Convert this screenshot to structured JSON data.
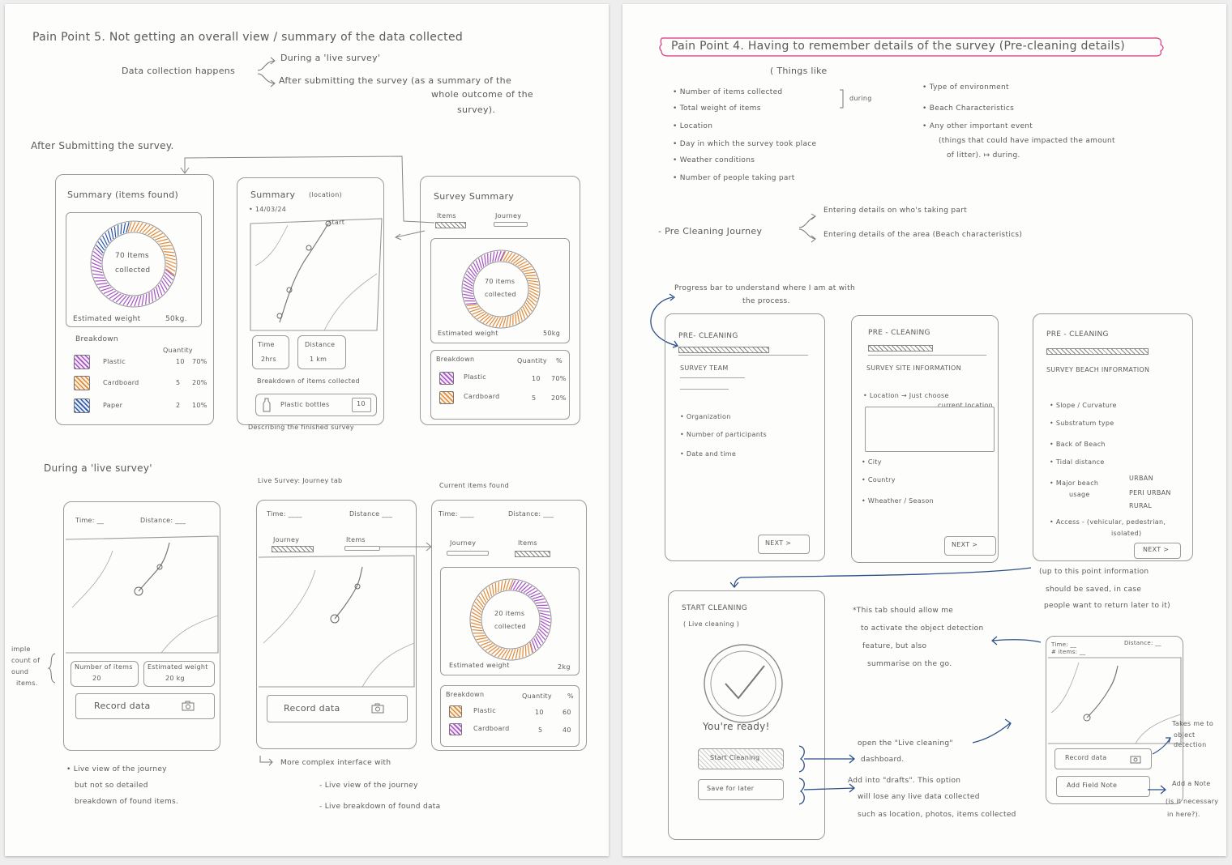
{
  "colors": {
    "plastic": "#a352c4",
    "cardboard": "#e08a3a",
    "paper": "#2a55a8",
    "pink_highlight": "#e0508f",
    "blue_arrow": "#2b4f86",
    "pencil": "#5a5a5a"
  },
  "left": {
    "title": "Pain Point 5.  Not getting an overall view / summary of the data collected",
    "collection_label": "Data collection happens",
    "branch1": "During a 'live survey'",
    "branch2_l1": "After submitting the survey (as a summary of the",
    "branch2_l2": "whole outcome of the",
    "branch2_l3": "survey).",
    "section_after": "After Submitting the survey.",
    "s1": {
      "title": "Summary (items found)",
      "donut_l1": "70 Items",
      "donut_l2": "collected",
      "weight_label": "Estimated weight",
      "weight_value": "50kg.",
      "breakdown": "Breakdown",
      "quantity": "Quantity",
      "rows": [
        {
          "name": "Plastic",
          "qty": "10",
          "pct": "70%"
        },
        {
          "name": "Cardboard",
          "qty": "5",
          "pct": "20%"
        },
        {
          "name": "Paper",
          "qty": "2",
          "pct": "10%"
        }
      ]
    },
    "s2": {
      "title": "Summary",
      "subtitle": "(location)",
      "date": "• 14/03/24",
      "start": "start",
      "time_label": "Time",
      "time_value": "2hrs",
      "distance_label": "Distance",
      "distance_value": "1 km",
      "breakdown": "Breakdown of items collected",
      "item": "Plastic bottles",
      "item_count": "10",
      "caption": "Describing the finished survey"
    },
    "s3": {
      "title": "Survey Summary",
      "tab_items": "Items",
      "tab_journey": "Journey",
      "donut_l1": "70 items",
      "donut_l2": "collected",
      "weight_label": "Estimated weight",
      "weight_value": "50kg",
      "breakdown": "Breakdown",
      "quantity": "Quantity",
      "pct_head": "%",
      "rows": [
        {
          "name": "Plastic",
          "qty": "10",
          "pct": "70%"
        },
        {
          "name": "Cardboard",
          "qty": "5",
          "pct": "20%"
        }
      ]
    },
    "section_live": "During a 'live survey'",
    "l1": {
      "time": "Time: __",
      "distance": "Distance: ___",
      "count_label": "Number of items",
      "count_value": "20",
      "weight_label": "Estimated weight",
      "weight_value": "20 kg",
      "record": "Record data"
    },
    "side_note": [
      "imple",
      "count of",
      "ound",
      "items."
    ],
    "l2": {
      "heading": "Live Survey: Journey tab",
      "time": "Time: ____",
      "distance": "Distance ___",
      "tab_journey": "Journey",
      "tab_items": "Items",
      "record": "Record data"
    },
    "l3": {
      "heading": "Current items found",
      "time": "Time: ____",
      "distance": "Distance: ___",
      "tab_journey": "Journey",
      "tab_items": "Items",
      "donut_l1": "20 items",
      "donut_l2": "collected",
      "weight_label": "Estimated weight",
      "weight_value": "2kg",
      "breakdown": "Breakdown",
      "quantity": "Quantity",
      "pct_head": "%",
      "rows": [
        {
          "name": "Plastic",
          "qty": "10",
          "pct": "60"
        },
        {
          "name": "Cardboard",
          "qty": "5",
          "pct": "40"
        }
      ]
    },
    "note1": [
      "• Live view of the journey",
      "but not so detailed",
      "breakdown of found items."
    ],
    "note2_head": "More complex interface with",
    "note2_items": [
      "- Live view of the journey",
      "- Live breakdown of found data"
    ]
  },
  "right": {
    "title": "Pain Point 4.  Having to remember details of the survey (Pre-cleaning details)",
    "things_like": "( Things like",
    "list_left": [
      "• Number of items collected",
      "• Total weight of items",
      "• Location",
      "• Day in which the survey took place",
      "• Weather conditions",
      "• Number of people taking part"
    ],
    "during1": "during",
    "list_right": [
      "• Type of environment",
      "• Beach Characteristics",
      "• Any other important event"
    ],
    "list_right_sub1": "(things that could have impacted the amount",
    "list_right_sub2": "of litter). ↦ during.",
    "journey_label": "- Pre Cleaning Journey",
    "journey_b1": "Entering details on who's taking part",
    "journey_b2": "Entering details of the area (Beach characteristics)",
    "progress_note1": "Progress bar to understand where I am at with",
    "progress_note2": "the process.",
    "p1": {
      "title": "PRE- CLEANING",
      "section": "SURVEY TEAM",
      "items": [
        "• Organization",
        "• Number of participants",
        "• Date and time"
      ],
      "next": "NEXT >"
    },
    "p2": {
      "title": "PRE - CLEANING",
      "section": "SURVEY SITE INFORMATION",
      "location": "• Location → Just choose",
      "location2": "current location",
      "items": [
        "• City",
        "• Country",
        "• Wheather / Season"
      ],
      "next": "NEXT >"
    },
    "p3": {
      "title": "PRE - CLEANING",
      "section": "SURVEY BEACH INFORMATION",
      "items": [
        "• Slope / Curvature",
        "• Substratum type",
        "• Back of Beach",
        "• Tidal distance"
      ],
      "usage_l1": "• Major beach",
      "usage_l2": "usage",
      "usage_opts": [
        "URBAN",
        "PERI URBAN",
        "RURAL"
      ],
      "access_l1": "• Access - (vehicular, pedestrian,",
      "access_l2": "isolated)",
      "next": "NEXT >"
    },
    "save_note": [
      "(up to this point information",
      "should be saved, in case",
      "people want to return later to it)"
    ],
    "s1": {
      "title": "START CLEANING",
      "subtitle": "( Live cleaning )",
      "ready": "You're ready!",
      "start_btn": "Start Cleaning",
      "save_btn": "Save for later"
    },
    "tab_note": [
      "*This tab should allow me",
      "to activate the object detection",
      "feature, but also",
      "summarise on the go."
    ],
    "open_note": [
      "open the \"Live cleaning\"",
      "dashboard."
    ],
    "drafts_note": [
      "Add into \"drafts\". This option",
      "will lose any live data collected",
      "such as location, photos, items collected"
    ],
    "live_phone": {
      "time": "Time: __",
      "items": "# items: __",
      "distance": "Distance: __",
      "record": "Record data",
      "note_btn": "Add Field Note"
    },
    "takes_me": [
      "Takes me to",
      "object",
      "detection"
    ],
    "add_note": [
      "Add a Note",
      "(is it necessary",
      "in here?)."
    ]
  }
}
